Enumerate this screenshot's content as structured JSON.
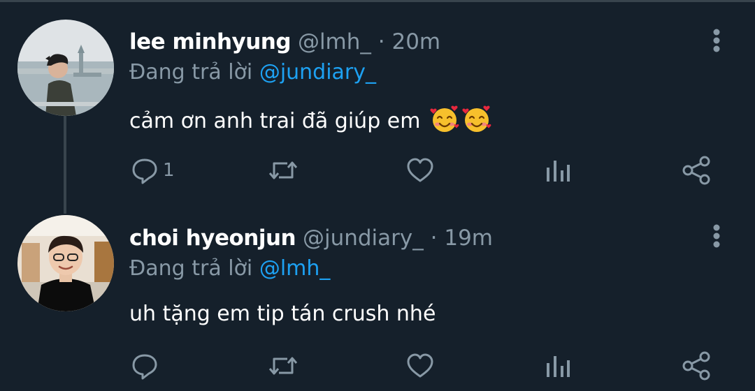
{
  "tweets": [
    {
      "display_name": "lee minhyung",
      "handle": "@lmh_",
      "separator": "·",
      "time": "20m",
      "reply_prefix": "Đang trả lời",
      "reply_mention": "@jundiary_",
      "text": "cảm ơn anh trai đã giúp em",
      "emojis": [
        "smiling-face-with-hearts-icon",
        "smiling-face-with-hearts-icon"
      ],
      "reply_count": "1"
    },
    {
      "display_name": "choi hyeonjun",
      "handle": "@jundiary_",
      "separator": "·",
      "time": "19m",
      "reply_prefix": "Đang trả lời",
      "reply_mention": "@lmh_",
      "text": "uh tặng em tip tán crush nhé",
      "emojis": [],
      "reply_count": ""
    }
  ],
  "colors": {
    "background": "#15202b",
    "primary_text": "#ffffff",
    "secondary_text": "#8899a6",
    "link": "#1da1f2",
    "divider": "#38444d"
  }
}
